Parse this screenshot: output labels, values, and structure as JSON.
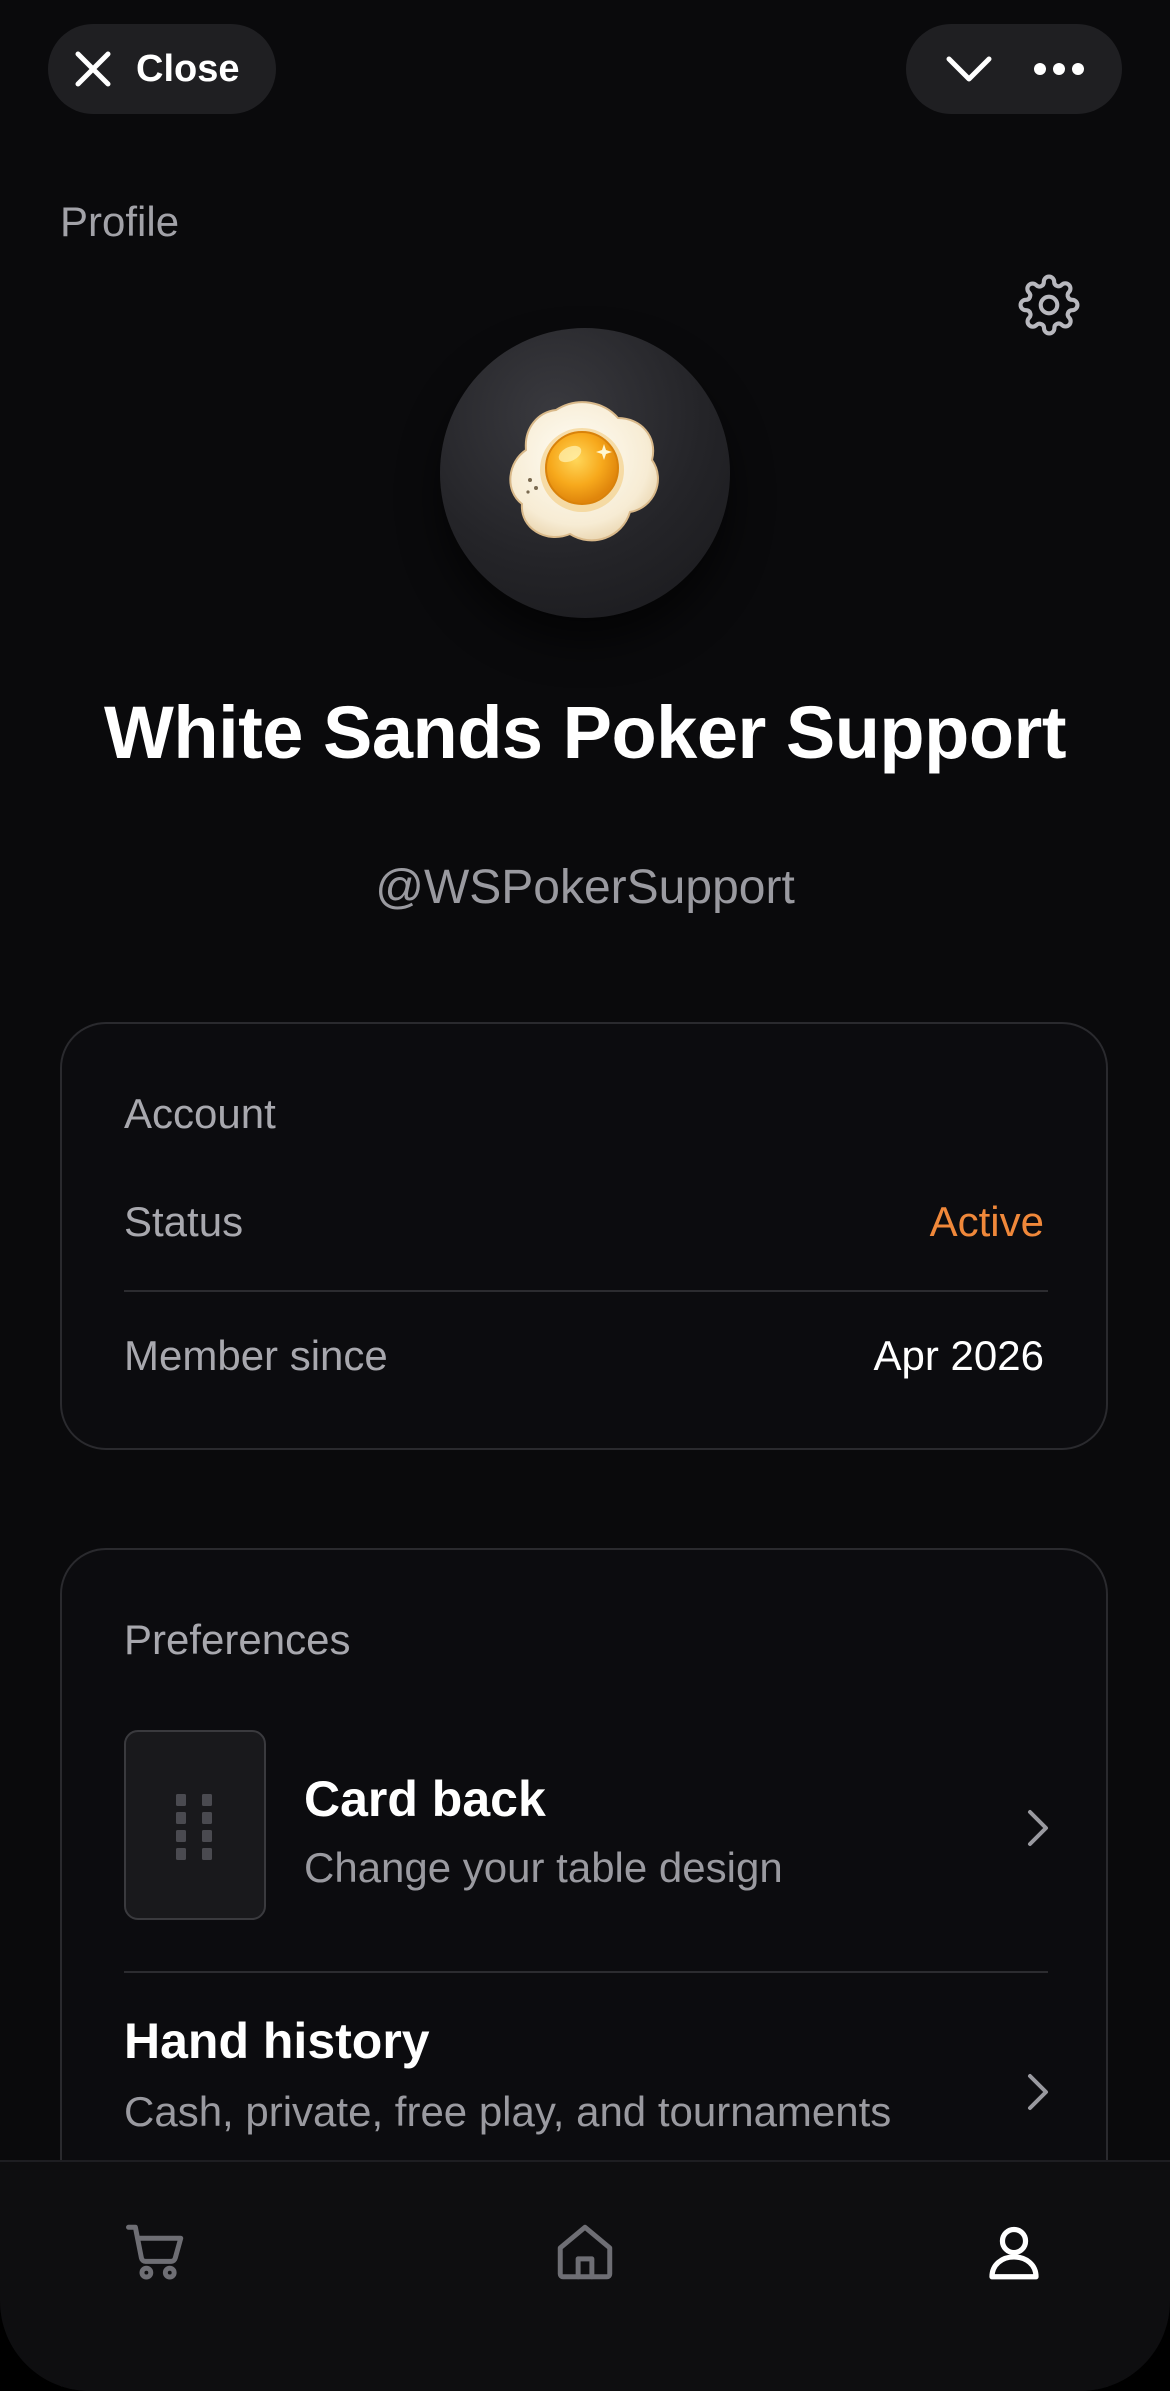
{
  "header": {
    "close_label": "Close",
    "close_icon": "close-x-icon",
    "collapse_icon": "chevron-down-icon",
    "more_icon": "more-horizontal-icon"
  },
  "page": {
    "label": "Profile",
    "settings_icon": "gear-icon"
  },
  "profile": {
    "avatar_icon": "fried-egg-icon",
    "name": "White Sands Poker Support",
    "handle": "@WSPokerSupport"
  },
  "account": {
    "title": "Account",
    "status_label": "Status",
    "status_value": "Active",
    "member_label": "Member since",
    "member_value": "Apr 2026"
  },
  "preferences": {
    "title": "Preferences",
    "items": [
      {
        "title": "Card back",
        "subtitle": "Change your table design",
        "icon": "card-back-thumbnail"
      },
      {
        "title": "Hand history",
        "subtitle": "Cash, private, free play, and tournaments",
        "icon": "chevron-right-icon"
      }
    ]
  },
  "tabbar": {
    "items": [
      {
        "name": "shop",
        "icon": "cart-icon",
        "active": false
      },
      {
        "name": "home",
        "icon": "home-icon",
        "active": false
      },
      {
        "name": "profile",
        "icon": "user-icon",
        "active": true
      }
    ]
  },
  "colors": {
    "background": "#0a0a0c",
    "accent_active": "#f0883a",
    "text_primary": "#ffffff",
    "text_secondary": "#a8a8ae"
  }
}
